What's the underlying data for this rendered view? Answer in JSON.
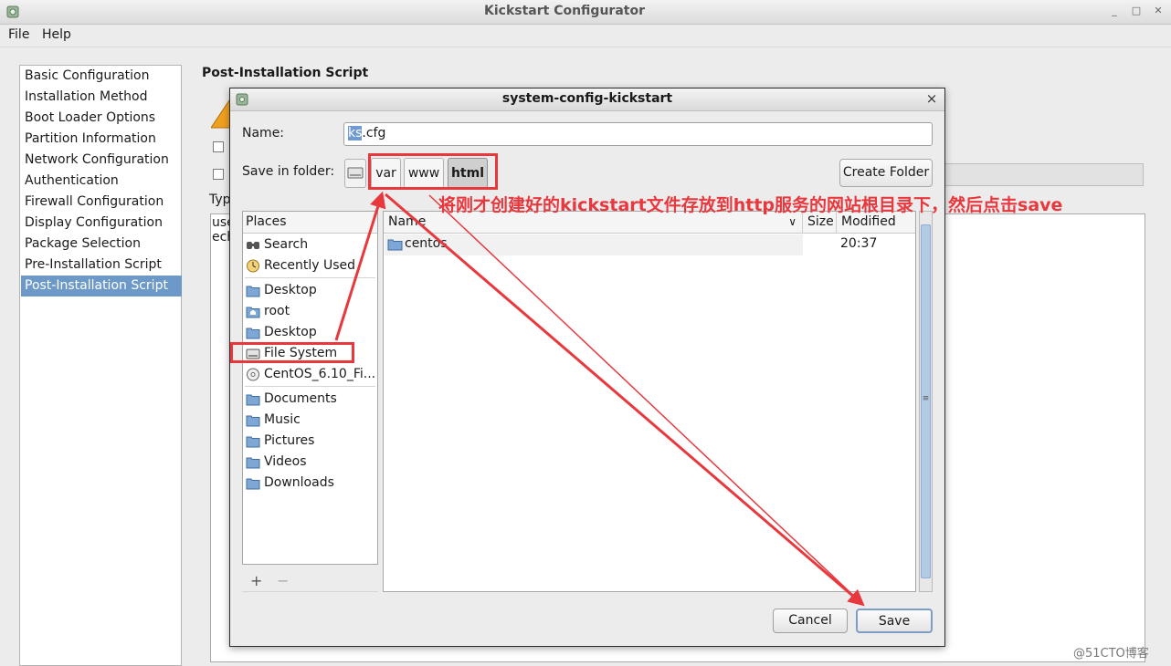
{
  "window": {
    "title": "Kickstart Configurator",
    "minimize_glyph": "_",
    "maximize_glyph": "□",
    "close_glyph": "✕"
  },
  "menu": [
    "File",
    "Help"
  ],
  "sidebar": {
    "items": [
      "Basic Configuration",
      "Installation Method",
      "Boot Loader Options",
      "Partition Information",
      "Network Configuration",
      "Authentication",
      "Firewall Configuration",
      "Display Configuration",
      "Package Selection",
      "Pre-Installation Script",
      "Post-Installation Script"
    ],
    "selected": "Post-Installation Script"
  },
  "main": {
    "section_title": "Post-Installation Script",
    "type_label": "Typ",
    "script_lines": [
      "use",
      "ech"
    ]
  },
  "dialog": {
    "title": "system-config-kickstart",
    "close_glyph": "×",
    "name_label": "Name:",
    "name_selected": "ks",
    "name_rest": ".cfg",
    "save_in_label": "Save in folder:",
    "path": [
      "var",
      "www",
      "html"
    ],
    "active_path": "html",
    "create_folder": "Create Folder",
    "places": {
      "header": "Places",
      "items": [
        {
          "label": "Search",
          "icon": "search-icon"
        },
        {
          "label": "Recently Used",
          "icon": "clock-icon"
        },
        {
          "label": "Desktop",
          "icon": "folder-icon"
        },
        {
          "label": "root",
          "icon": "home-folder-icon"
        },
        {
          "label": "Desktop",
          "icon": "folder-icon"
        },
        {
          "label": "File System",
          "icon": "drive-icon"
        },
        {
          "label": "CentOS_6.10_Fi...",
          "icon": "disc-icon"
        },
        {
          "label": "Documents",
          "icon": "folder-icon"
        },
        {
          "label": "Music",
          "icon": "folder-icon"
        },
        {
          "label": "Pictures",
          "icon": "folder-icon"
        },
        {
          "label": "Videos",
          "icon": "folder-icon"
        },
        {
          "label": "Downloads",
          "icon": "folder-icon"
        }
      ],
      "add_glyph": "+",
      "remove_glyph": "−"
    },
    "files": {
      "columns": {
        "name": "Name",
        "sort_glyph": "∨",
        "size": "Size",
        "modified": "Modified"
      },
      "rows": [
        {
          "name": "centos",
          "size": "",
          "modified": "20:37"
        }
      ]
    },
    "scroll_grip_glyph": "≡",
    "cancel": "Cancel",
    "save": "Save"
  },
  "annotation": {
    "text": "将刚才创建好的kickstart文件存放到http服务的网站根目录下，然后点击save",
    "color": "#e8383d"
  },
  "watermark": "@51CTO博客",
  "colors": {
    "selection": "#6d99c9",
    "text_selection": "#6f9bd0",
    "annotation": "#e8383d"
  }
}
